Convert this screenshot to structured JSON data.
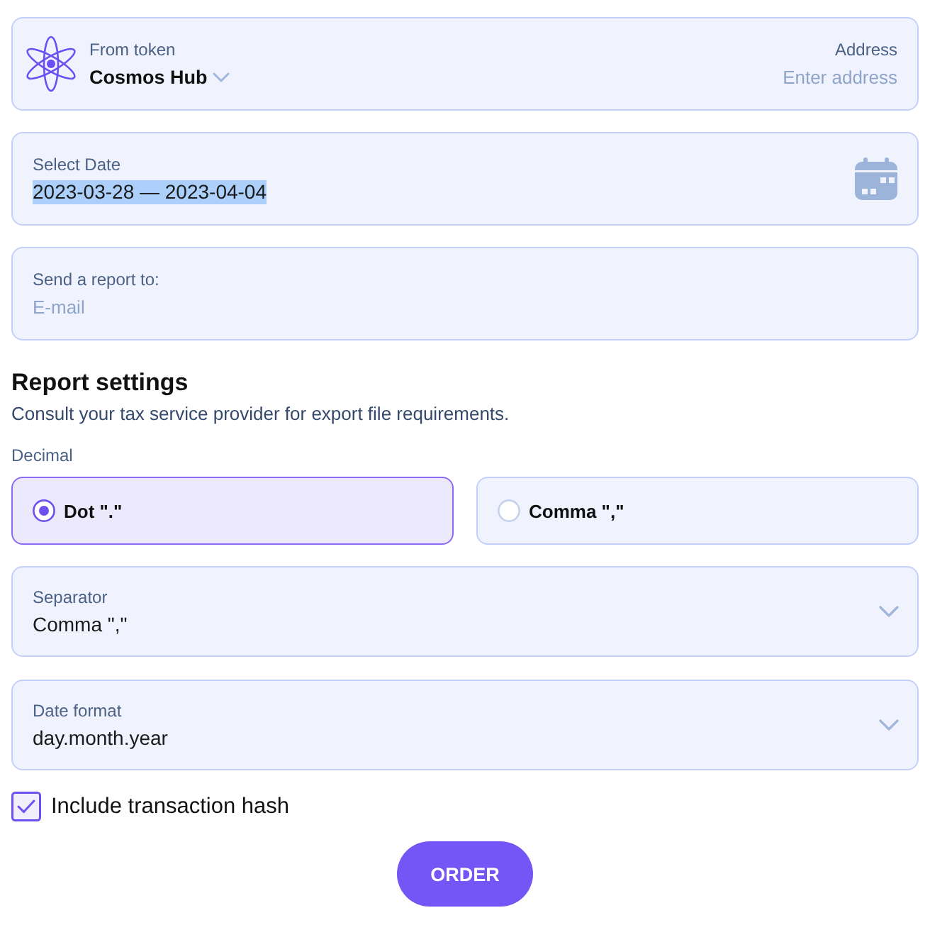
{
  "token": {
    "label": "From token",
    "value": "Cosmos Hub"
  },
  "address": {
    "label": "Address",
    "placeholder": "Enter address"
  },
  "date": {
    "label": "Select Date",
    "value": "2023-03-28 — 2023-04-04",
    "text_selected": true
  },
  "report": {
    "label": "Send a report to:",
    "placeholder": "E-mail"
  },
  "settings": {
    "title": "Report settings",
    "subtitle": "Consult your tax service provider for export file requirements."
  },
  "decimal": {
    "label": "Decimal",
    "options": [
      {
        "label": "Dot \".\"",
        "selected": true
      },
      {
        "label": "Comma \",\"",
        "selected": false
      }
    ]
  },
  "dropdowns": [
    {
      "label": "Separator",
      "value": "Comma \",\""
    },
    {
      "label": "Date format",
      "value": "day.month.year"
    }
  ],
  "checkbox": {
    "label": "Include transaction hash",
    "checked": true
  },
  "button": "ORDER"
}
